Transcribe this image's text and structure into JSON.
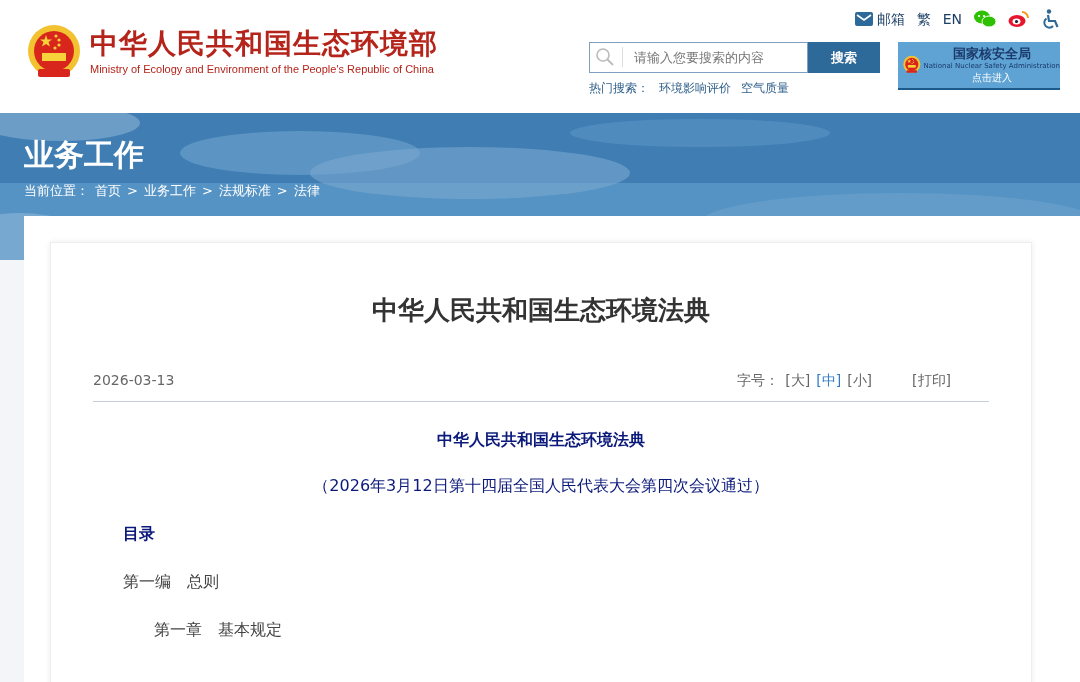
{
  "header": {
    "title": "中华人民共和国生态环境部",
    "subtitle": "Ministry of Ecology and Environment of the People's Republic of China",
    "top_links": [
      {
        "kind": "mail",
        "label": "邮箱"
      },
      {
        "kind": "text",
        "label": "繁"
      },
      {
        "kind": "text",
        "label": "EN"
      },
      {
        "kind": "wechat"
      },
      {
        "kind": "weibo"
      },
      {
        "kind": "accessibility"
      }
    ],
    "search": {
      "placeholder": "请输入您要搜索的内容",
      "button": "搜索"
    },
    "hot": {
      "label": "热门搜索：",
      "items": [
        "环境影响评价",
        "空气质量"
      ]
    },
    "nnsa": {
      "title": "国家核安全局",
      "subtitle": "National Nuclear Safety Administration",
      "action": "点击进入"
    }
  },
  "banner": {
    "title": "业务工作",
    "breadcrumb_label": "当前位置：",
    "breadcrumb": [
      "首页",
      "业务工作",
      "法规标准",
      "法律"
    ],
    "separator": ">"
  },
  "article": {
    "title": "中华人民共和国生态环境法典",
    "date": "2026-03-13",
    "font_size_label": "字号：",
    "font_sizes": [
      {
        "label": "[大]",
        "selected": false
      },
      {
        "label": "[中]",
        "selected": true
      },
      {
        "label": "[小]",
        "selected": false
      }
    ],
    "print": "[打印]",
    "body": [
      {
        "kind": "heading",
        "text": "中华人民共和国生态环境法典"
      },
      {
        "kind": "note",
        "text": "（2026年3月12日第十四届全国人民代表大会第四次会议通过）"
      },
      {
        "kind": "toc",
        "text": "目录"
      },
      {
        "kind": "part",
        "text": "第一编　总则"
      },
      {
        "kind": "chapter",
        "text": "第一章　基本规定"
      }
    ]
  }
}
